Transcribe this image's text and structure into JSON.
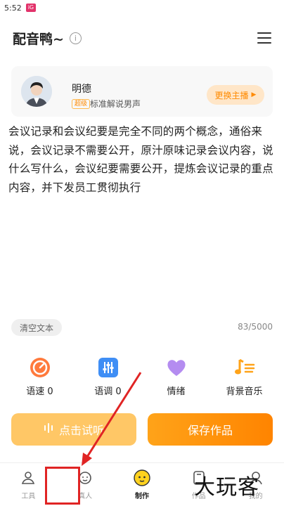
{
  "statusbar": {
    "time": "5:52",
    "badge": "iG"
  },
  "header": {
    "title": "配音鸭~",
    "info_glyph": "i"
  },
  "voice": {
    "name": "明德",
    "level": "超级",
    "desc": "标准解说男声",
    "switch_label": "更换主播"
  },
  "editor": {
    "text": "会议记录和会议纪要是完全不同的两个概念，通俗来说，会议记录不需要公开，原汁原味记录会议内容，说什么写什么，会议纪要需要公开，提炼会议记录的重点内容，并下发员工贯彻执行",
    "clear_label": "清空文本",
    "counter": "83/5000"
  },
  "tools": [
    {
      "label": "语速 0",
      "icon": "speed-gauge-icon"
    },
    {
      "label": "语调 0",
      "icon": "tone-sliders-icon"
    },
    {
      "label": "情绪",
      "icon": "heart-icon"
    },
    {
      "label": "背景音乐",
      "icon": "music-note-icon"
    }
  ],
  "actions": {
    "listen_label": "点击试听",
    "save_label": "保存作品"
  },
  "bottom_nav": [
    {
      "label": "工具",
      "icon": "tool-icon"
    },
    {
      "label": "真人",
      "icon": "headset-face-icon"
    },
    {
      "label": "制作",
      "icon": "duck-icon"
    },
    {
      "label": "作品",
      "icon": "document-icon"
    },
    {
      "label": "我的",
      "icon": "person-icon"
    }
  ],
  "watermark": "大玩客",
  "colors": {
    "accent": "#ff8a00",
    "highlight": "#e02424",
    "listen_bg": "#ffc766"
  }
}
